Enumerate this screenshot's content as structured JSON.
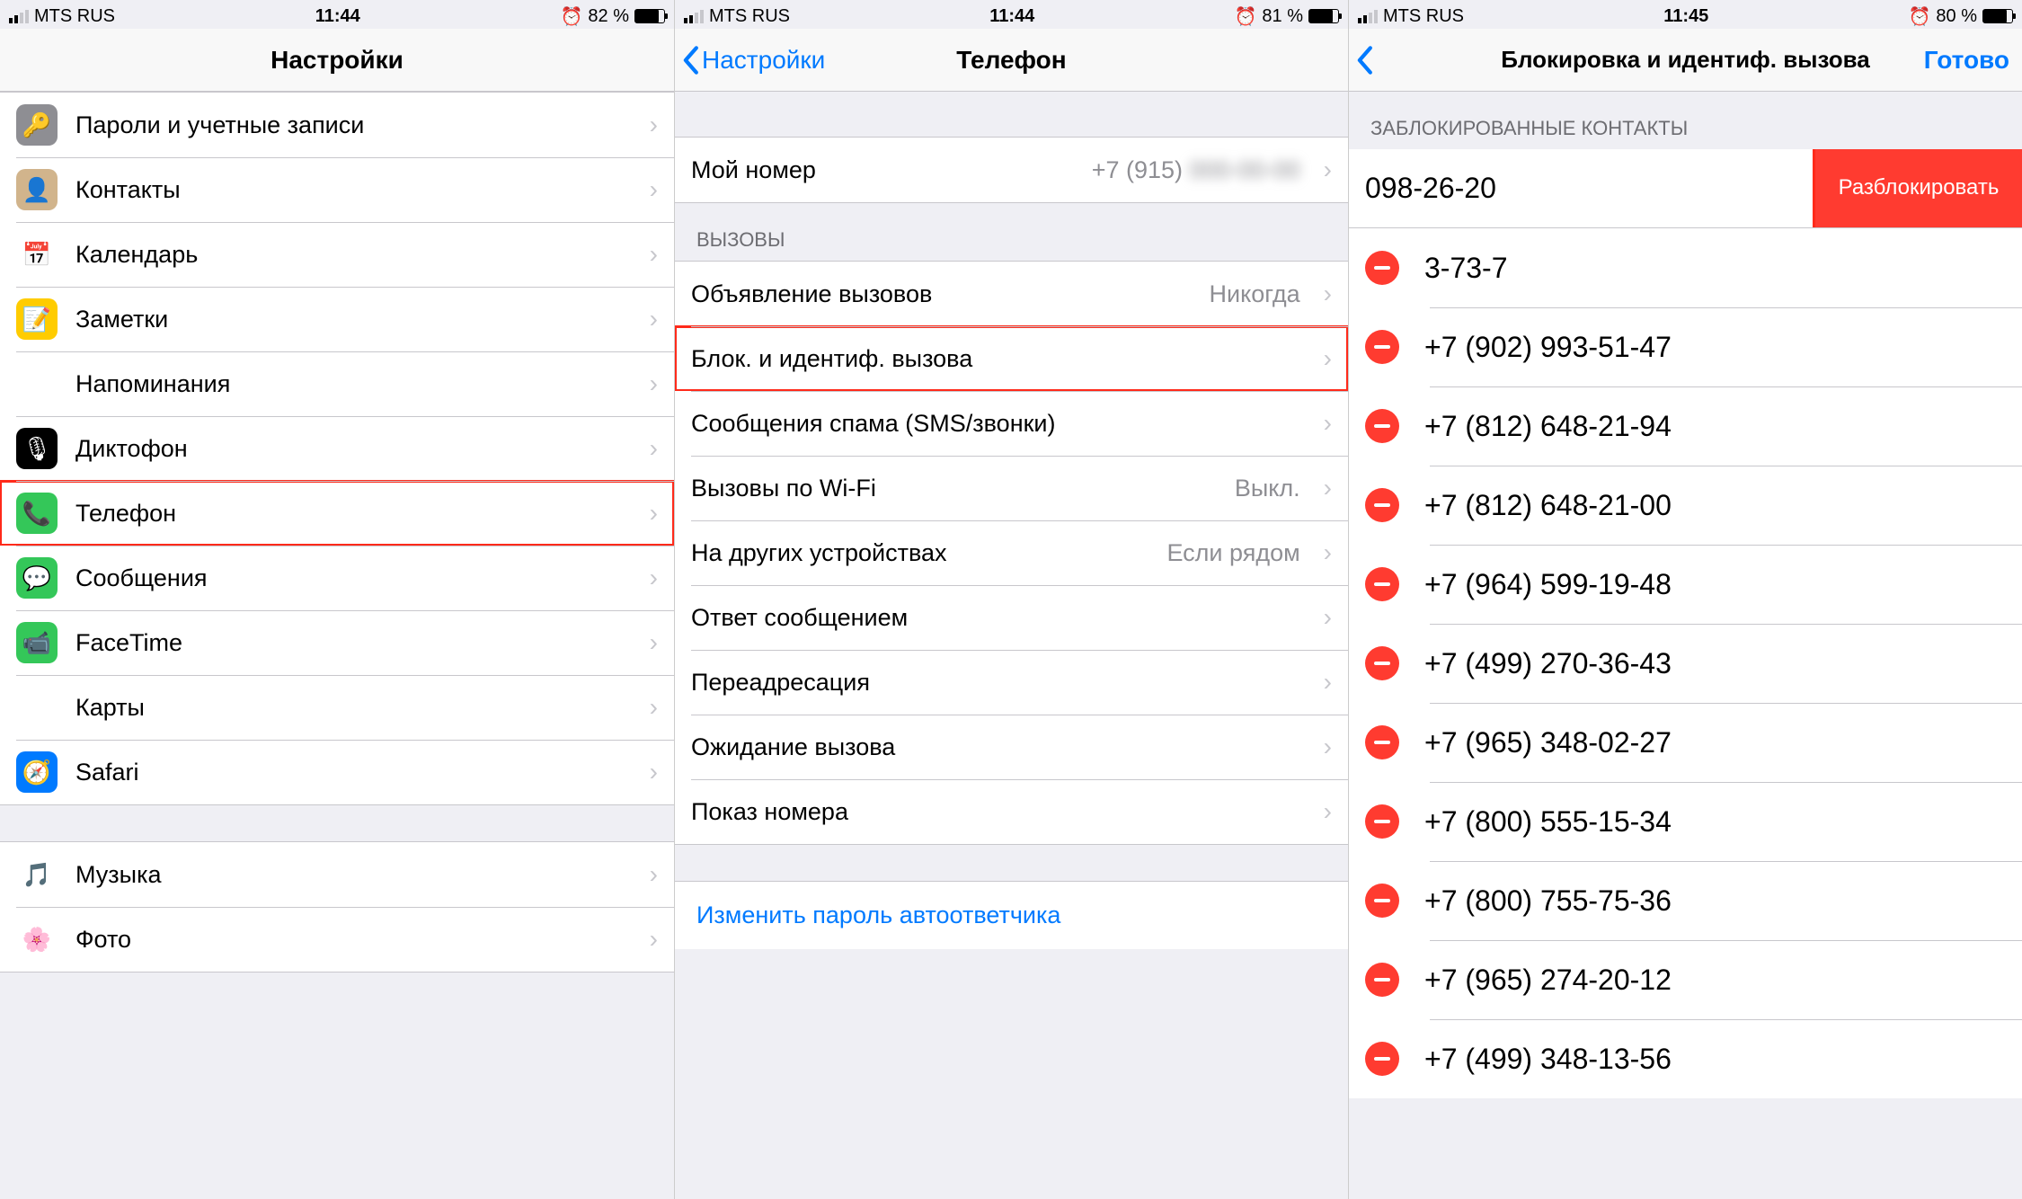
{
  "panel1": {
    "status": {
      "carrier": "MTS RUS",
      "time": "11:44",
      "battery_pct": "82 %"
    },
    "nav": {
      "title": "Настройки"
    },
    "rows": [
      {
        "icon_bg": "#8e8e93",
        "glyph": "🔑",
        "label": "Пароли и учетные записи"
      },
      {
        "icon_bg": "#d1b48c",
        "glyph": "👤",
        "label": "Контакты"
      },
      {
        "icon_bg": "#ffffff",
        "glyph": "📅",
        "label": "Календарь"
      },
      {
        "icon_bg": "#ffcc00",
        "glyph": "📝",
        "label": "Заметки"
      },
      {
        "icon_bg": "#ffffff",
        "glyph": "☑",
        "label": "Напоминания"
      },
      {
        "icon_bg": "#000000",
        "glyph": "🎙",
        "label": "Диктофон"
      },
      {
        "icon_bg": "#34c759",
        "glyph": "📞",
        "label": "Телефон",
        "highlight": true
      },
      {
        "icon_bg": "#34c759",
        "glyph": "💬",
        "label": "Сообщения"
      },
      {
        "icon_bg": "#34c759",
        "glyph": "📹",
        "label": "FaceTime"
      },
      {
        "icon_bg": "#ffffff",
        "glyph": "🗺",
        "label": "Карты"
      },
      {
        "icon_bg": "#007aff",
        "glyph": "🧭",
        "label": "Safari"
      }
    ],
    "rows2": [
      {
        "icon_bg": "#ffffff",
        "glyph": "🎵",
        "label": "Музыка"
      },
      {
        "icon_bg": "#ffffff",
        "glyph": "🌸",
        "label": "Фото"
      }
    ]
  },
  "panel2": {
    "status": {
      "carrier": "MTS RUS",
      "time": "11:44",
      "battery_pct": "81 %"
    },
    "nav": {
      "back": "Настройки",
      "title": "Телефон"
    },
    "my_number": {
      "label": "Мой номер",
      "value": "+7 (915)"
    },
    "section_calls": "ВЫЗОВЫ",
    "calls": [
      {
        "label": "Объявление вызовов",
        "value": "Никогда"
      },
      {
        "label": "Блок. и идентиф. вызова",
        "value": "",
        "highlight": true
      },
      {
        "label": "Сообщения спама (SMS/звонки)",
        "value": ""
      },
      {
        "label": "Вызовы по Wi-Fi",
        "value": "Выкл."
      },
      {
        "label": "На других устройствах",
        "value": "Если рядом"
      },
      {
        "label": "Ответ сообщением",
        "value": ""
      },
      {
        "label": "Переадресация",
        "value": ""
      },
      {
        "label": "Ожидание вызова",
        "value": ""
      },
      {
        "label": "Показ номера",
        "value": ""
      }
    ],
    "footer_link": "Изменить пароль автоответчика"
  },
  "panel3": {
    "status": {
      "carrier": "MTS RUS",
      "time": "11:45",
      "battery_pct": "80 %"
    },
    "nav": {
      "title": "Блокировка и идентиф. вызова",
      "done": "Готово"
    },
    "section": "ЗАБЛОКИРОВАННЫЕ КОНТАКТЫ",
    "swiped": {
      "number": "098-26-20",
      "action": "Разблокировать"
    },
    "blocked": [
      "3-73-7",
      "+7 (902) 993-51-47",
      "+7 (812) 648-21-94",
      "+7 (812) 648-21-00",
      "+7 (964) 599-19-48",
      "+7 (499) 270-36-43",
      "+7 (965) 348-02-27",
      "+7 (800) 555-15-34",
      "+7 (800) 755-75-36",
      "+7 (965) 274-20-12",
      "+7 (499) 348-13-56"
    ]
  }
}
